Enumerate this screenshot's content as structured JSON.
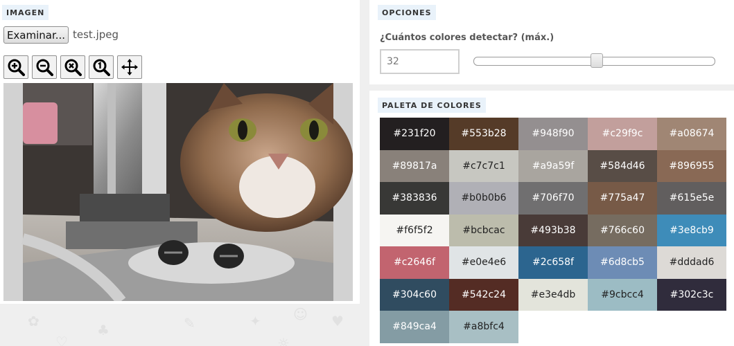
{
  "imagen": {
    "section_label": "IMAGEN",
    "browse_label": "Examinar...",
    "file_name": "test.jpeg",
    "tools": [
      {
        "name": "zoom-in-icon",
        "glyph": "+"
      },
      {
        "name": "zoom-out-icon",
        "glyph": "−"
      },
      {
        "name": "zoom-reset-icon",
        "glyph": "×"
      },
      {
        "name": "zoom-actual-size-icon",
        "glyph": "1"
      },
      {
        "name": "move-icon",
        "glyph": "move"
      }
    ]
  },
  "opciones": {
    "section_label": "OPCIONES",
    "count_label": "¿Cuántos colores detectar? (máx.)",
    "count_value": "32",
    "slider_fraction": 0.5
  },
  "paleta": {
    "section_label": "PALETA DE COLORES",
    "colors": [
      "#231f20",
      "#553b28",
      "#948f90",
      "#c29f9c",
      "#a08674",
      "#89817a",
      "#c7c7c1",
      "#a9a59f",
      "#584d46",
      "#896955",
      "#383836",
      "#b0b0b6",
      "#706f70",
      "#775a47",
      "#615e5e",
      "#f6f5f2",
      "#bcbcac",
      "#493b38",
      "#766c60",
      "#3e8cb9",
      "#c2646f",
      "#e0e4e6",
      "#2c658f",
      "#6d8cb5",
      "#dddad6",
      "#304c60",
      "#542c24",
      "#e3e4db",
      "#9cbcc4",
      "#302c3c",
      "#849ca4",
      "#a8bfc4"
    ]
  }
}
